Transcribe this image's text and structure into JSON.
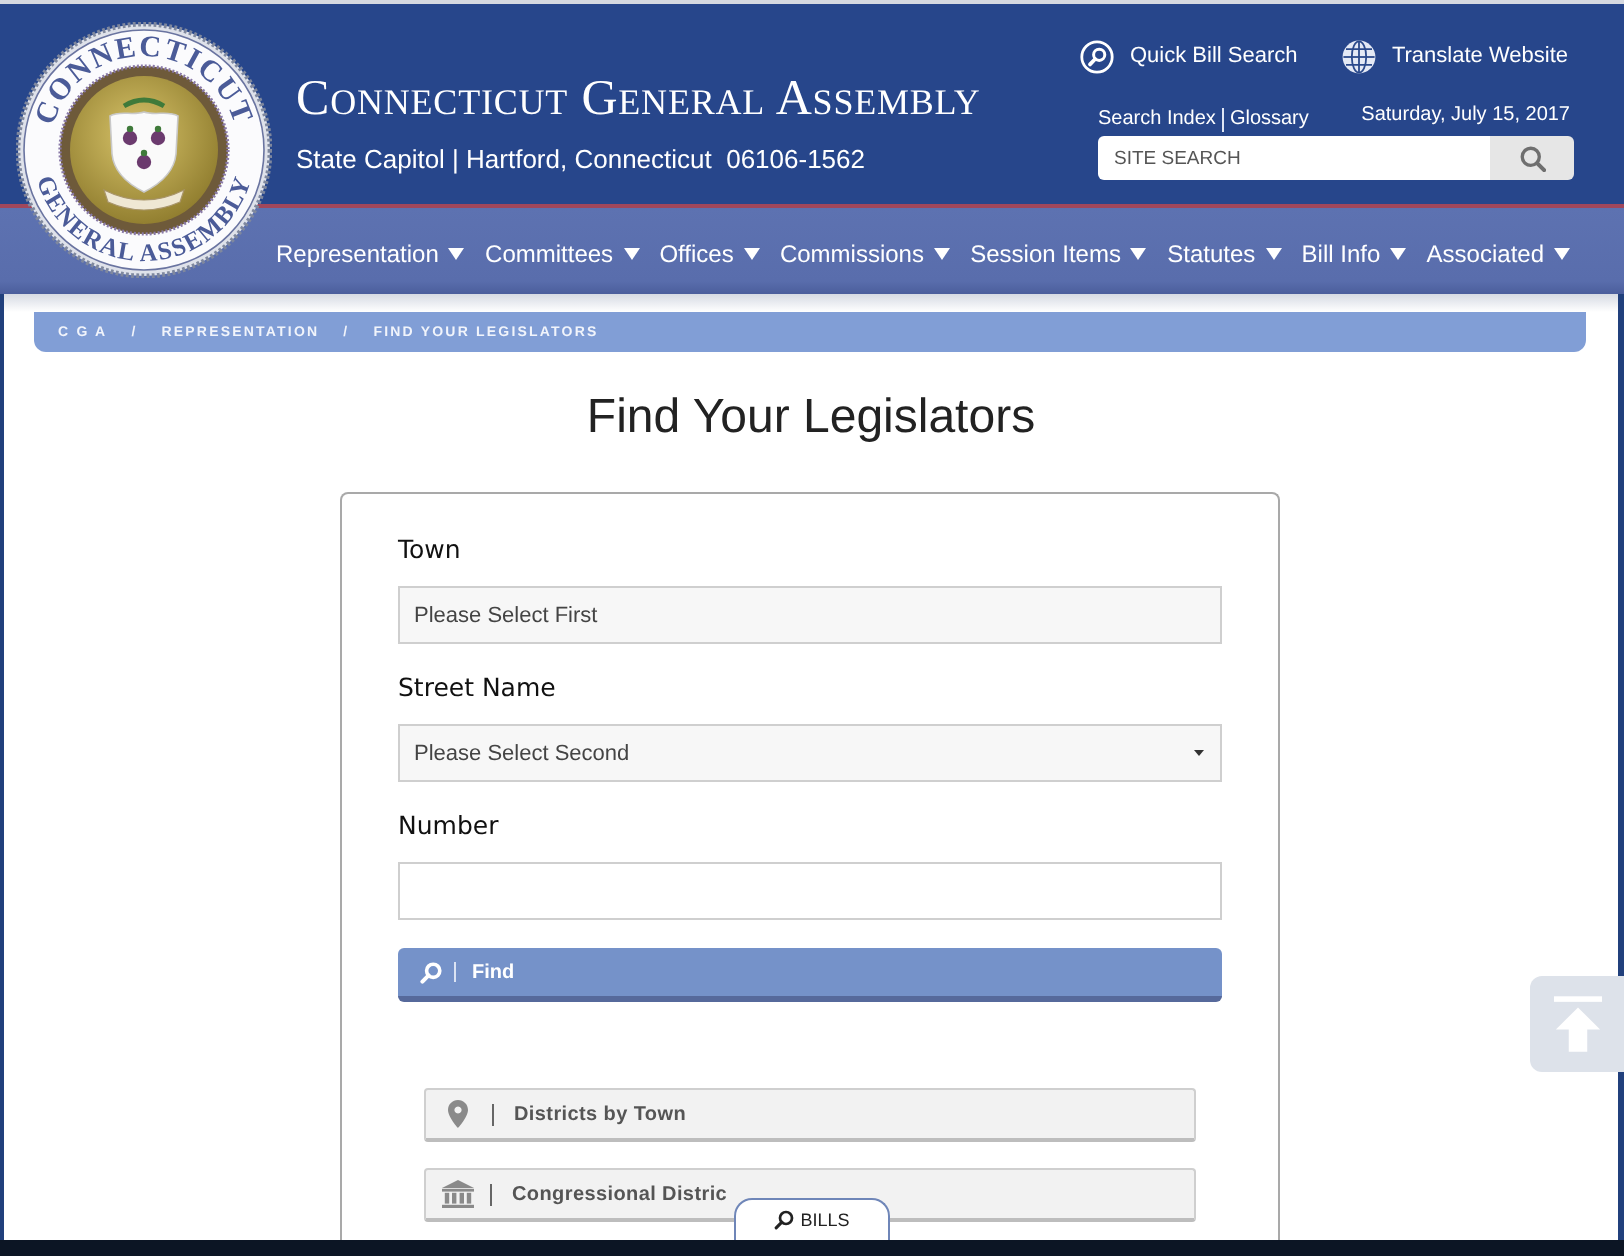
{
  "header": {
    "seal": {
      "top_text": "CONNECTICUT",
      "bottom_text": "GENERAL ASSEMBLY"
    },
    "title": "Connecticut General Assembly",
    "address": "State Capitol | Hartford, Connecticut  06106-1562",
    "quick_links": [
      {
        "label": "Quick Bill Search",
        "kind": "search"
      },
      {
        "label": "Translate Website",
        "kind": "translate"
      }
    ],
    "index_links": [
      "Search Index",
      "Glossary"
    ],
    "date": "Saturday, July 15, 2017",
    "search": {
      "placeholder": "SITE SEARCH"
    }
  },
  "nav": [
    "Representation",
    "Committees",
    "Offices",
    "Commissions",
    "Session Items",
    "Statutes",
    "Bill Info",
    "Associated"
  ],
  "breadcrumb": {
    "items": [
      "C G A",
      "REPRESENTATION",
      "FIND YOUR LEGISLATORS"
    ],
    "separator": "/"
  },
  "title": "Find Your Legislators",
  "form": {
    "fields": [
      {
        "label": "Town",
        "kind": "combo",
        "placeholder": "Please Select First"
      },
      {
        "label": "Street Name",
        "kind": "select",
        "placeholder": "Please Select Second"
      },
      {
        "label": "Number",
        "kind": "text"
      }
    ],
    "submit": "Find"
  },
  "district_links": [
    {
      "label": "Districts by Town",
      "kind": "town"
    },
    {
      "label": "Congressional Distric",
      "kind": "congressional"
    }
  ],
  "bills_tab": "BILLS"
}
